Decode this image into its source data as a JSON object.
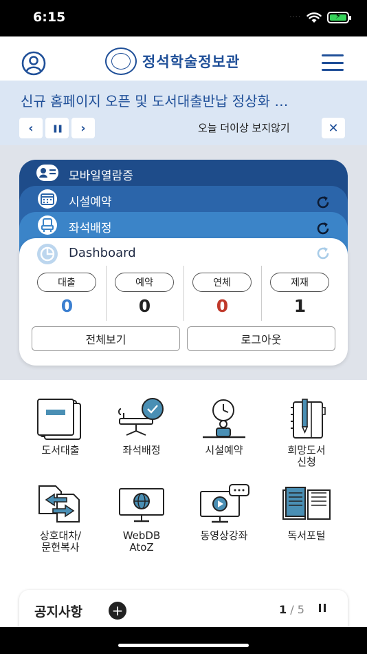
{
  "status": {
    "time": "6:15",
    "dots": "····"
  },
  "header": {
    "title": "정석학술정보관",
    "user_icon": "user-circle-icon",
    "menu_icon": "hamburger-icon"
  },
  "banner": {
    "text": "신규 홈페이지 오픈 및 도서대출반납 정상화 …",
    "hide_label": "오늘 더이상 보지않기",
    "prev": "‹",
    "pause": "❚❚",
    "next": "›",
    "close": "✕"
  },
  "stack": {
    "layer1": {
      "label": "모바일열람증",
      "icon": "id-card-icon"
    },
    "layer2": {
      "label": "시설예약",
      "icon": "calendar-icon"
    },
    "layer3": {
      "label": "좌석배정",
      "icon": "seat-icon"
    }
  },
  "dashboard": {
    "title": "Dashboard",
    "stats": [
      {
        "label": "대출",
        "value": "0",
        "color": "#3b7fd0"
      },
      {
        "label": "예약",
        "value": "0",
        "color": "#222222"
      },
      {
        "label": "연체",
        "value": "0",
        "color": "#c0392b"
      },
      {
        "label": "제재",
        "value": "1",
        "color": "#222222"
      }
    ],
    "view_all": "전체보기",
    "logout": "로그아웃"
  },
  "services": [
    {
      "label": "도서대출",
      "icon": "book-icon"
    },
    {
      "label": "좌석배정",
      "icon": "seat-chat-icon"
    },
    {
      "label": "시설예약",
      "icon": "clock-desk-icon"
    },
    {
      "label": "희망도서\n신청",
      "icon": "notebook-pen-icon"
    },
    {
      "label": "상호대차/\n문헌복사",
      "icon": "doc-exchange-icon"
    },
    {
      "label": "WebDB\nAtoZ",
      "icon": "globe-monitor-icon"
    },
    {
      "label": "동영상강좌",
      "icon": "video-lecture-icon"
    },
    {
      "label": "독서포털",
      "icon": "open-book-icon"
    }
  ],
  "notice": {
    "title": "공지사항",
    "add": "+",
    "page_current": "1",
    "page_total": "/ 5"
  }
}
